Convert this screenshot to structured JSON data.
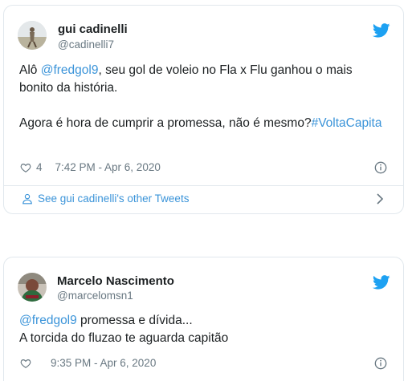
{
  "tweets": [
    {
      "author_name": "gui cadinelli",
      "author_handle": "@cadinelli7",
      "body": {
        "line1_prefix": "Alô ",
        "mention": "@fredgol9",
        "line1_suffix": ", seu gol de voleio no Fla x Flu ganhou o mais bonito da história.",
        "para2_text": "Agora é hora de cumprir a promessa, não é mesmo?",
        "hashtag": "#VoltaCapita"
      },
      "like_count": "4",
      "timestamp": "7:42 PM - Apr 6, 2020",
      "footer_link": "See gui cadinelli's other Tweets",
      "icons": [
        "twitter-bird-icon",
        "heart-icon",
        "info-icon",
        "person-icon",
        "chevron-right-icon"
      ]
    },
    {
      "author_name": "Marcelo Nascimento",
      "author_handle": "@marcelomsn1",
      "body": {
        "mention": "@fredgol9",
        "line1_suffix": " promessa e dívida...",
        "line2": "A torcida do fluzao te aguarda capitão"
      },
      "timestamp": "9:35 PM - Apr 6, 2020",
      "icons": [
        "twitter-bird-icon",
        "heart-icon",
        "info-icon"
      ]
    }
  ],
  "colors": {
    "link": "#3b94d9",
    "muted": "#697882",
    "border": "#e1e8ed",
    "twitter_blue": "#1da1f2"
  }
}
